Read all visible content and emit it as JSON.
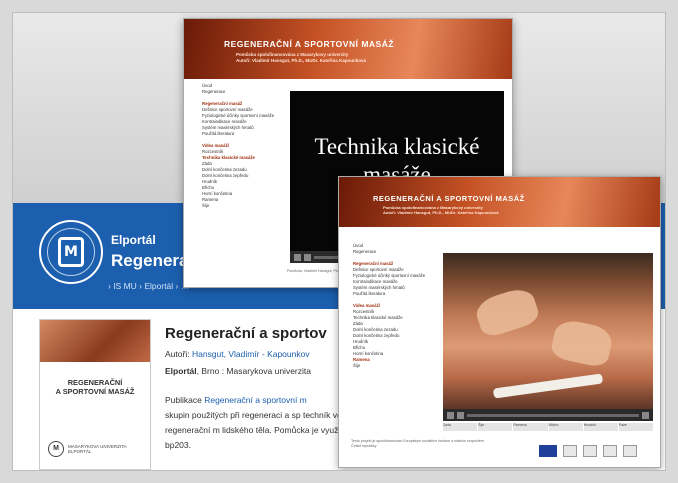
{
  "portal": {
    "label": "Elportál",
    "title": "Regeneraci",
    "breadcrumb": "› IS MU › Elportál › …"
  },
  "publication": {
    "title": "Regenerační a sportov",
    "authors_prefix": "Autoři:",
    "authors_link": "Hansgut, Vladimír - Kapounkov",
    "publisher_name": "Elportál",
    "publisher_rest": ", Brno : Masarykova univerzita",
    "desc_intro": "Publikace ",
    "desc_link": "Regenerační a sportovní m",
    "desc_body": "skupin použitých při regeneraci a sp techník ve spojení s teoretickými znal rekondiční, relaxační a regenerační m lidského těla. Pomůcka je využívána v předmětech FSpS:bp311, bp307, bk403, bk307 a bp203."
  },
  "cover": {
    "title_line1": "REGENERAČNÍ",
    "title_line2": "A SPORTOVNÍ MASÁŽ",
    "seal": "M",
    "uni_line1": "MASARYKOVA UNIVERZITA",
    "uni_line2": "ELPORTÁL"
  },
  "shot": {
    "banner_title": "REGENERAČNÍ A SPORTOVNÍ MASÁŽ",
    "banner_sub1": "Pomůcka spolufinancována z Masarykovy univerzity",
    "banner_sub2": "Autoři: Vladimír Hansgut, Ph.D., MUDr. Kateřina Kapounková",
    "video_text": "Technika klasické masáže",
    "nav_top": [
      "Úvod",
      "Regenerace"
    ],
    "nav_heading1": "Regenerační masáž",
    "nav_items1": [
      "Definice sportovní masáže",
      "Fyziologické účinky sportovní masáže",
      "Kontraindikace masáže",
      "Systém masérských hmatů",
      "Použitá literatura"
    ],
    "nav_heading2": "Videa masáží",
    "nav_items2": [
      "Rozcestník",
      "Technika klasické masáže",
      "Záda",
      "Dolní končetina zezadu",
      "Dolní končetina zepředu",
      "Hrudník",
      "Břicho",
      "Horní končetina",
      "Ramena",
      "Šíje"
    ],
    "nav_selected": "Technika klasické masáže",
    "footer": "Pomůcka, Vladimír Hansgut, Ph.D., MUDr. Kateřina Kapounková, Fakulta sportovních studií Masarykovy univerzity",
    "footer2": "Tento projekt je spolufinancován Evropským sociálním fondem a státním rozpočtem České republiky",
    "strip_labels": [
      "Záda",
      "Šíje",
      "Ramena",
      "Břicho",
      "Hrudník",
      "Paže"
    ]
  }
}
